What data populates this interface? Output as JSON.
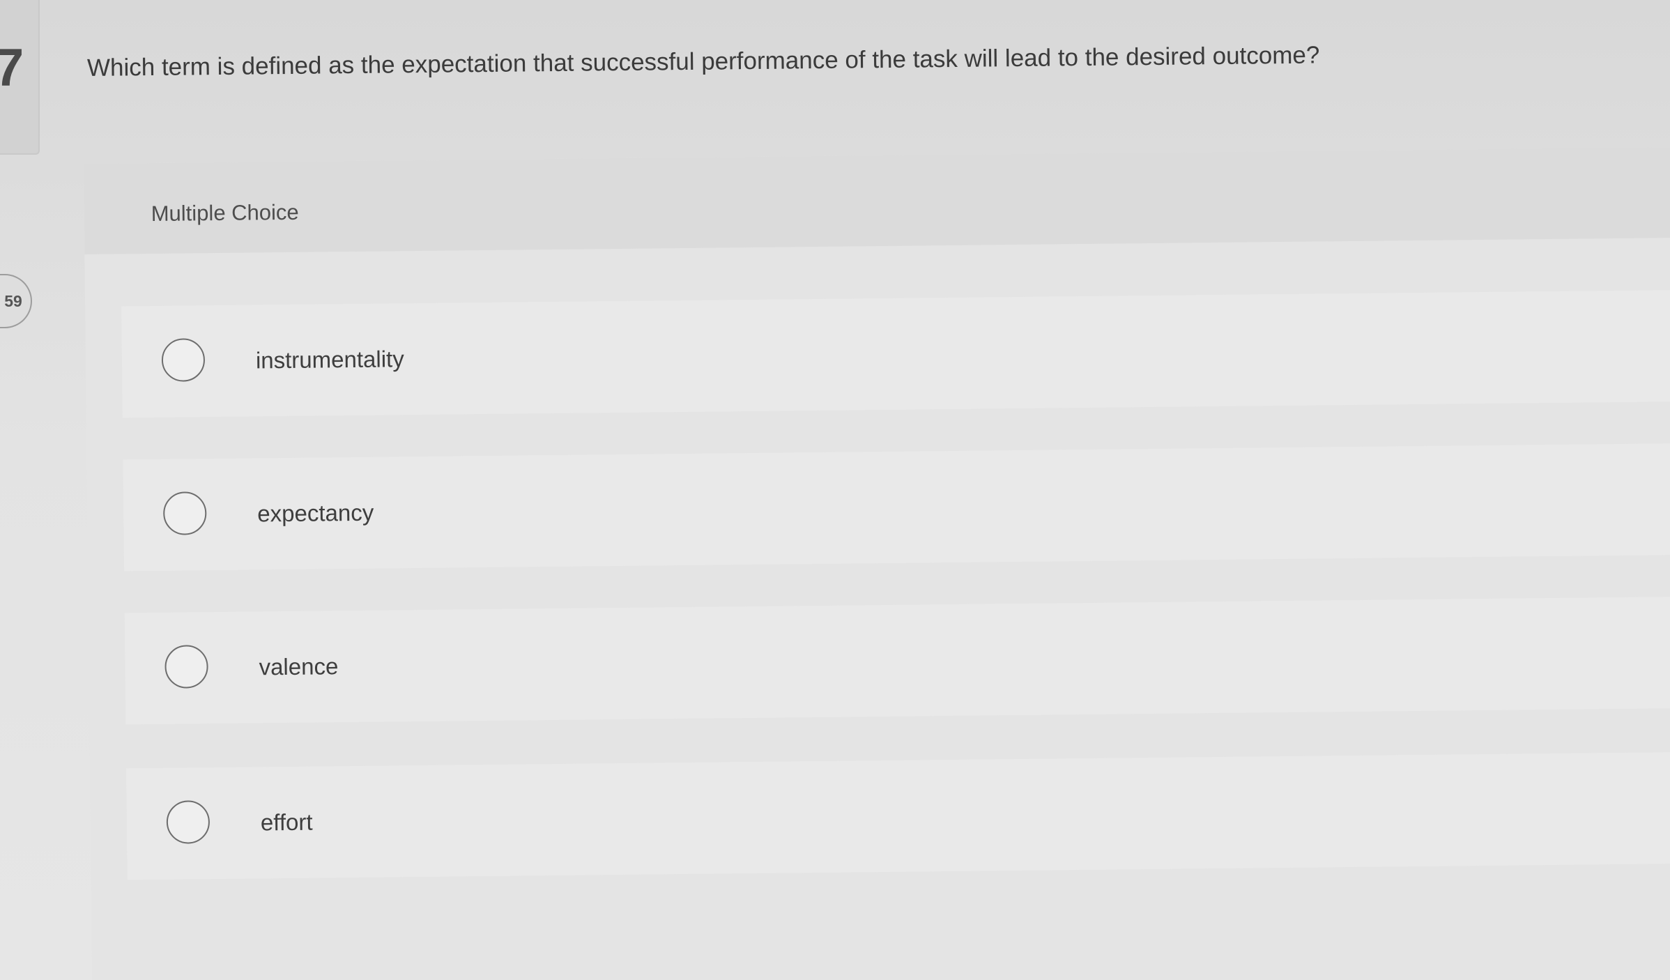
{
  "sidebar": {
    "question_number": "7",
    "points": "59"
  },
  "question": {
    "text": "Which term is defined as the expectation that successful performance of the task will lead to the desired outcome?"
  },
  "answer_block": {
    "type_label": "Multiple Choice",
    "options": [
      {
        "label": "instrumentality",
        "selected": false
      },
      {
        "label": "expectancy",
        "selected": false
      },
      {
        "label": "valence",
        "selected": false
      },
      {
        "label": "effort",
        "selected": false
      }
    ]
  }
}
